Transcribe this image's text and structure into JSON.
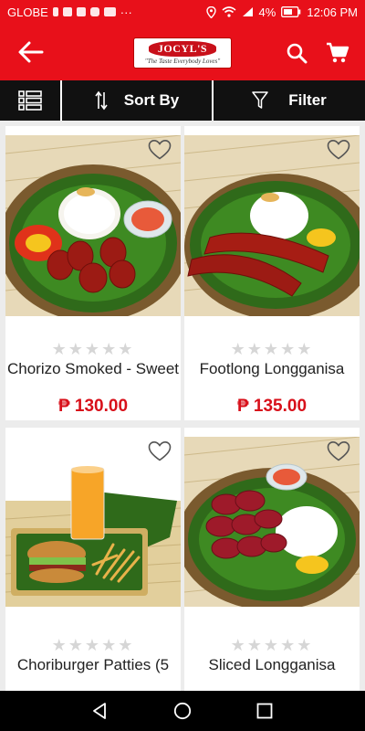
{
  "status_bar": {
    "carrier": "GLOBE",
    "battery": "4%",
    "time": "12:06 PM",
    "overflow": "···"
  },
  "app_bar": {
    "logo_name": "JOCYL'S",
    "logo_tagline": "\"The Taste Everybody Loves\""
  },
  "toolbar": {
    "sort_label": "Sort By",
    "filter_label": "Filter"
  },
  "products": [
    {
      "name": "Chorizo Smoked - Sweet",
      "price": "₱ 130.00",
      "rating": 0,
      "stars": "★★★★★",
      "image": "chorizo-rice-plate"
    },
    {
      "name": "Footlong Longganisa",
      "price": "₱ 135.00",
      "rating": 0,
      "stars": "★★★★★",
      "image": "footlong-sausage-plate"
    },
    {
      "name": "Choriburger Patties (5",
      "price": "",
      "rating": 0,
      "stars": "★★★★★",
      "image": "choriburger-plate"
    },
    {
      "name": "Sliced Longganisa",
      "price": "",
      "rating": 0,
      "stars": "★★★★★",
      "image": "sliced-longganisa-plate"
    }
  ],
  "colors": {
    "brand_red": "#e8101a",
    "price_red": "#d8101a",
    "toolbar_black": "#111111"
  }
}
